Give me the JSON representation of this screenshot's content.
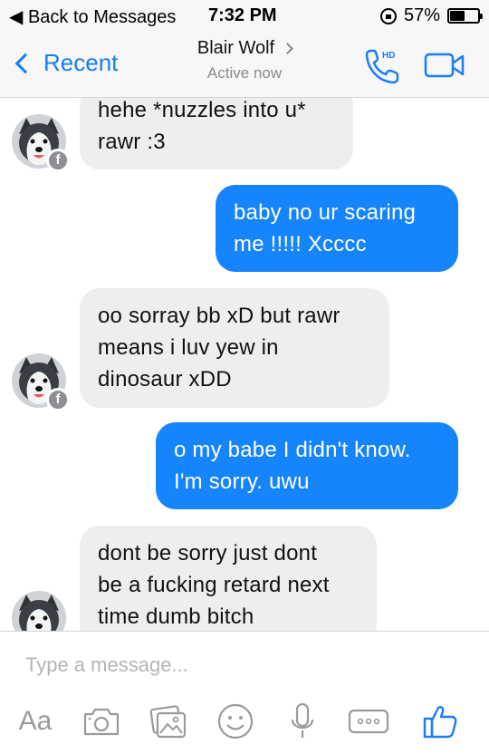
{
  "status_bar": {
    "back_label": "◀ Back to Messages",
    "time": "7:32 PM",
    "battery_percent_label": "57%",
    "battery_level": 0.57
  },
  "header": {
    "back_label": "Recent",
    "contact_name": "Blair Wolf",
    "presence": "Active now",
    "call_icon": "phone-hd-icon",
    "call_badge": "HD",
    "video_icon": "video-camera-icon"
  },
  "messages": [
    {
      "direction": "incoming",
      "text_lines": [
        "hehe *nuzzles into u*",
        "rawr :3"
      ]
    },
    {
      "direction": "outgoing",
      "text_lines": [
        "baby no ur scaring",
        "me !!!!! Xcccc"
      ]
    },
    {
      "direction": "incoming",
      "text_lines": [
        "oo sorray bb xD but rawr",
        "means i luv yew in",
        "dinosaur xDD"
      ]
    },
    {
      "direction": "outgoing",
      "text_lines": [
        "o my babe I didn't know.",
        "I'm sorry. uwu"
      ]
    },
    {
      "direction": "incoming",
      "text_lines": [
        "dont be sorry just dont",
        "be a fucking retard next",
        "time dumb bitch"
      ]
    }
  ],
  "avatar_badge": "f",
  "composer": {
    "placeholder": "Type a message...",
    "toolbar": {
      "text_label": "Aa",
      "icons": [
        "camera-icon",
        "gallery-icon",
        "emoji-icon",
        "microphone-icon",
        "more-icon",
        "thumbs-up-icon"
      ]
    }
  },
  "colors": {
    "accent": "#1a7cf2",
    "outgoing_bubble": "#1684fb",
    "incoming_bubble": "#eeeef0"
  }
}
